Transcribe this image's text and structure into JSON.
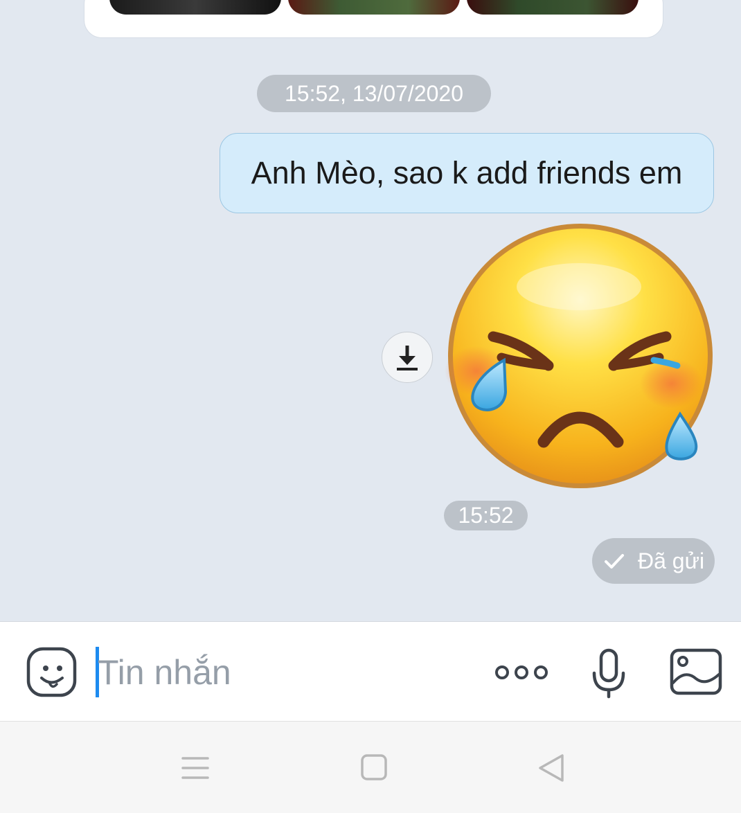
{
  "conversation": {
    "timestamp_header": "15:52, 13/07/2020",
    "message_text": "Anh Mèo, sao k add friends em",
    "sticker_icon": "crying-angry-face-sticker",
    "sticker_time": "15:52",
    "status_text": "Đã gửi"
  },
  "composer": {
    "placeholder": "Tin nhắn",
    "icons": [
      "emoji-icon",
      "more-icon",
      "microphone-icon",
      "image-icon"
    ]
  },
  "navbar": {
    "icons": [
      "menu-icon",
      "home-icon",
      "back-icon"
    ]
  },
  "colors": {
    "chat_background": "#e2e8f0",
    "bubble_background": "#d5ecfb",
    "bubble_border": "#9cc7e3",
    "pill_background": "#bcc2c9",
    "caret": "#1d8bf0"
  }
}
